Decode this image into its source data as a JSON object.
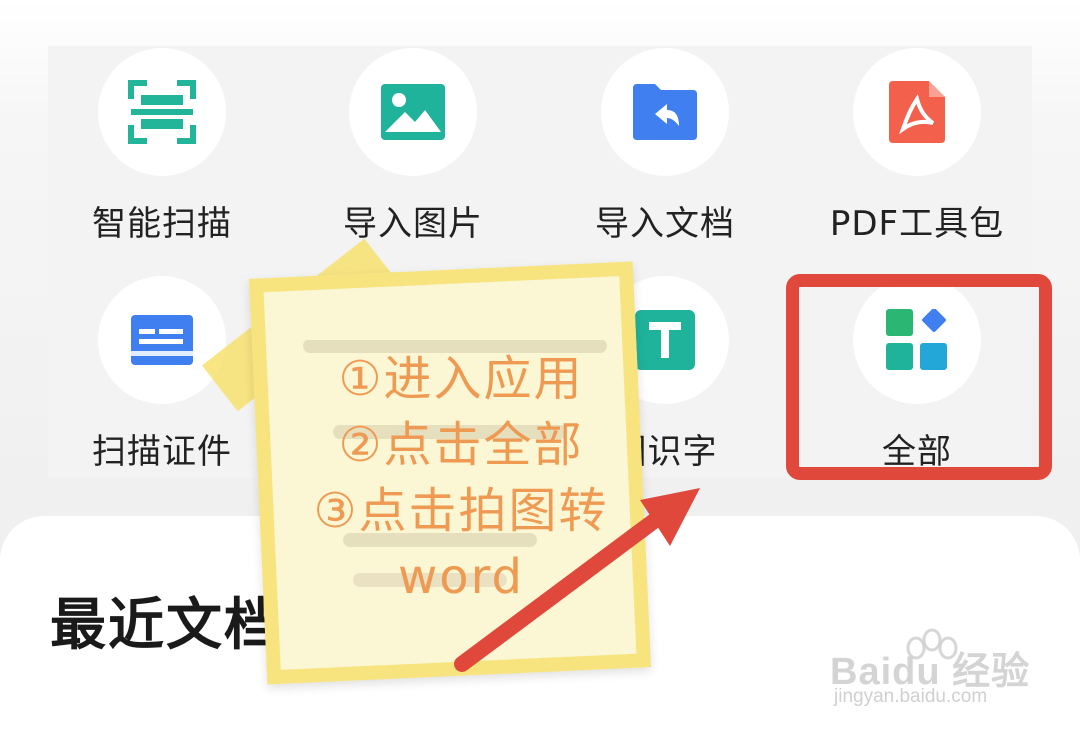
{
  "tools": [
    {
      "label": "智能扫描",
      "icon": "scan-icon",
      "color": "#23b59a"
    },
    {
      "label": "导入图片",
      "icon": "image-icon",
      "color": "#1fb39b"
    },
    {
      "label": "导入文档",
      "icon": "import-folder-icon",
      "color": "#3f7ff0"
    },
    {
      "label": "PDF工具包",
      "icon": "pdf-icon",
      "color": "#f3614d"
    },
    {
      "label": "扫描证件",
      "icon": "id-card-icon",
      "color": "#3f7ff0"
    },
    {
      "label": "图识字",
      "icon": "text-recognition-icon",
      "color": "#1fb39b"
    },
    {
      "label": "全部",
      "icon": "all-apps-icon",
      "color": "#1fb39b"
    }
  ],
  "recent_title": "最近文档",
  "note": {
    "lines": [
      "①进入应用",
      "②点击全部",
      "③点击拍图转",
      "word"
    ]
  },
  "watermark": {
    "brand_a": "Bai",
    "brand_b": "du",
    "brand_c": "经验",
    "url": "jingyan.baidu.com"
  },
  "colors": {
    "highlight": "#e0483c",
    "note_text": "#ef9a52",
    "arrow": "#e0483c"
  }
}
